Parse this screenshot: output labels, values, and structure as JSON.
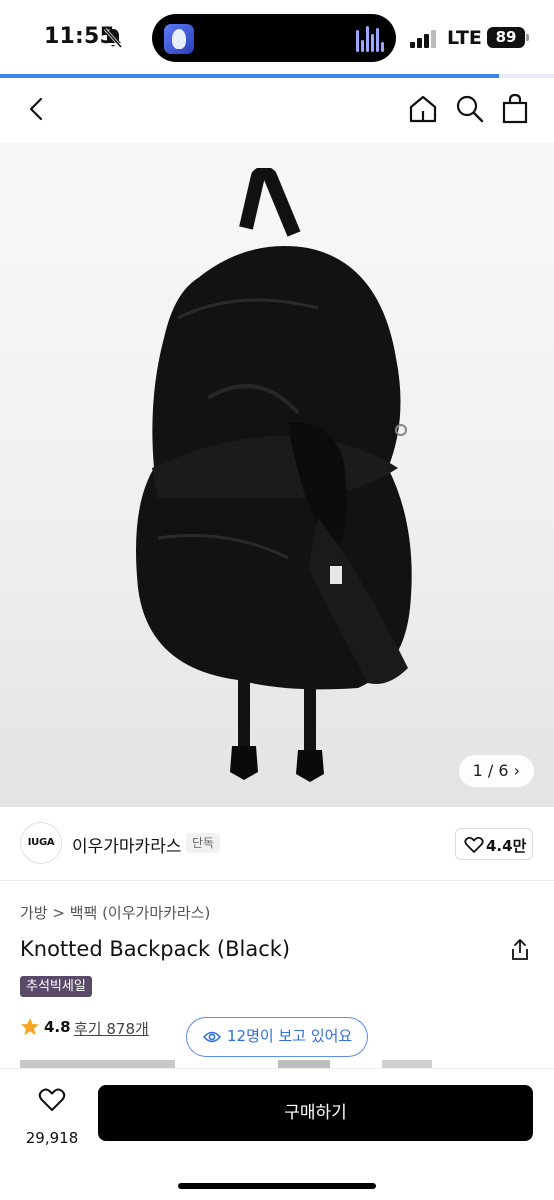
{
  "status_bar": {
    "time": "11:55",
    "network": "LTE",
    "battery": "89"
  },
  "gallery": {
    "progress_fraction": 0.9,
    "counter": "1 / 6 ›"
  },
  "brand": {
    "logo_text": "IUGA",
    "name": "이우가마카라스",
    "tag": "단독",
    "likes": "4.4만"
  },
  "product": {
    "breadcrumb": "가방 > 백팩 (이우가마카라스)",
    "title": "Knotted Backpack (Black)",
    "sale_badge": "추석빅세일",
    "rating": "4.8",
    "review_link": "후기 878개"
  },
  "viewing": {
    "text": "12명이 보고 있어요"
  },
  "bottom_bar": {
    "wish_count": "29,918",
    "buy_label": "구매하기"
  },
  "icons": {
    "back": "chevron-left-icon",
    "home": "home-icon",
    "search": "search-icon",
    "cart": "shopping-bag-icon",
    "share": "share-icon",
    "star": "star-icon",
    "eye": "eye-icon",
    "heart": "heart-icon"
  },
  "colors": {
    "accent_blue": "#3e86e6",
    "sale_badge_bg": "#5a4a6a",
    "star": "#f5a623",
    "buy_button": "#000000"
  }
}
